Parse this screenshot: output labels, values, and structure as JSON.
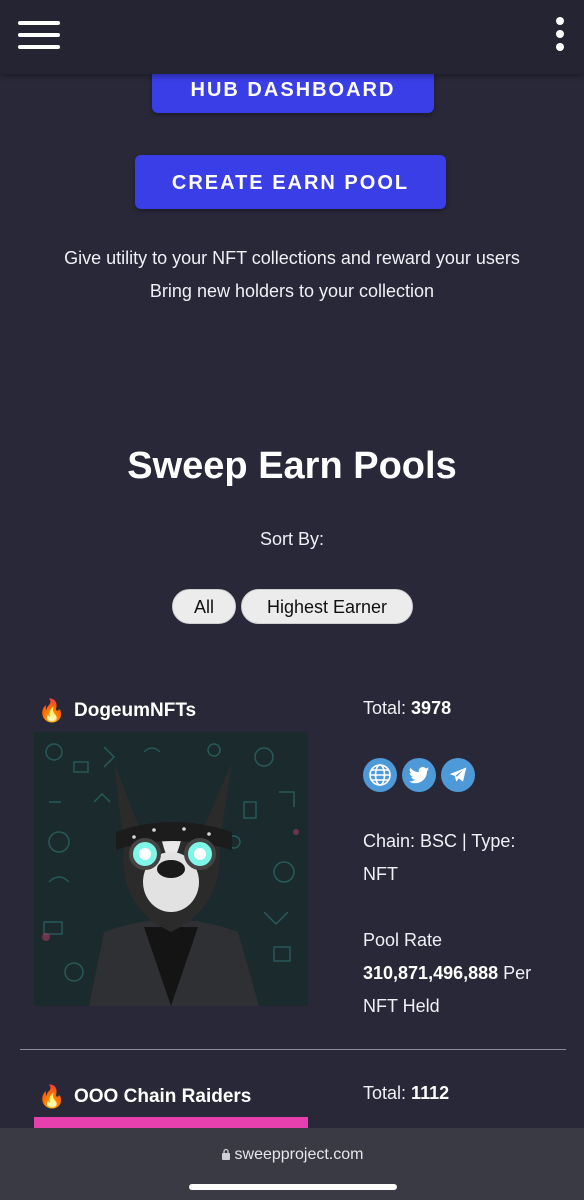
{
  "header": {
    "menu_icon": "hamburger-menu-icon",
    "more_icon": "kebab-more-icon"
  },
  "buttons": {
    "hub": "HUB DASHBOARD",
    "create": "CREATE EARN POOL"
  },
  "tagline": {
    "line1": "Give utility to your NFT collections and reward your users",
    "line2": "Bring new holders to your collection"
  },
  "section": {
    "title": "Sweep Earn Pools",
    "sort_label": "Sort By:"
  },
  "sort_options": [
    "All",
    "Highest Earner"
  ],
  "pools": [
    {
      "icon": "🔥",
      "name": "DogeumNFTs",
      "total_label": "Total:",
      "total": "3978",
      "socials": [
        "globe-icon",
        "twitter-icon",
        "telegram-icon"
      ],
      "chain_text": "Chain: BSC | Type:",
      "type_text": "NFT",
      "rate_label": "Pool Rate",
      "rate_value": "310,871,496,888",
      "rate_per": "Per",
      "rate_suffix": "NFT Held"
    },
    {
      "icon": "🔥",
      "name": "OOO Chain Raiders",
      "total_label": "Total:",
      "total": "1112"
    }
  ],
  "browser": {
    "url": "sweepproject.com"
  },
  "colors": {
    "background": "#292838",
    "button": "#3a3ee6",
    "social": "#4e9ad8",
    "second_pool_banner": "#e63fae"
  }
}
